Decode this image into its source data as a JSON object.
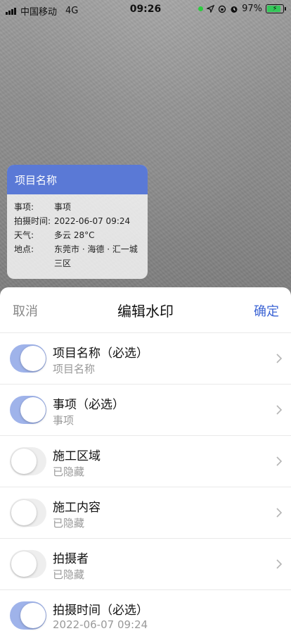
{
  "status_bar": {
    "carrier": "中国移动",
    "network": "4G",
    "time": "09:26",
    "battery": "97%",
    "icons": [
      "location-icon",
      "screen-rotation-lock-icon",
      "alarm-icon"
    ]
  },
  "watermark": {
    "title": "项目名称",
    "rows": [
      {
        "label": "事项:",
        "value": "事项"
      },
      {
        "label": "拍摄时间:",
        "value": "2022-06-07 09:24"
      },
      {
        "label": "天气:",
        "value": "多云  28°C"
      },
      {
        "label": "地点:",
        "value": "东莞市 · 海德 · 汇一城三区"
      }
    ],
    "header_color": "#5a79d6"
  },
  "sheet": {
    "cancel": "取消",
    "title": "编辑水印",
    "confirm": "确定",
    "accent": "#3c64d4",
    "items": [
      {
        "title": "项目名称（必选）",
        "subtitle": "项目名称",
        "enabled": true
      },
      {
        "title": "事项（必选）",
        "subtitle": "事项",
        "enabled": true
      },
      {
        "title": "施工区域",
        "subtitle": "已隐藏",
        "enabled": false
      },
      {
        "title": "施工内容",
        "subtitle": "已隐藏",
        "enabled": false
      },
      {
        "title": "拍摄者",
        "subtitle": "已隐藏",
        "enabled": false
      },
      {
        "title": "拍摄时间（必选）",
        "subtitle": "2022-06-07 09:24",
        "enabled": true
      }
    ]
  }
}
